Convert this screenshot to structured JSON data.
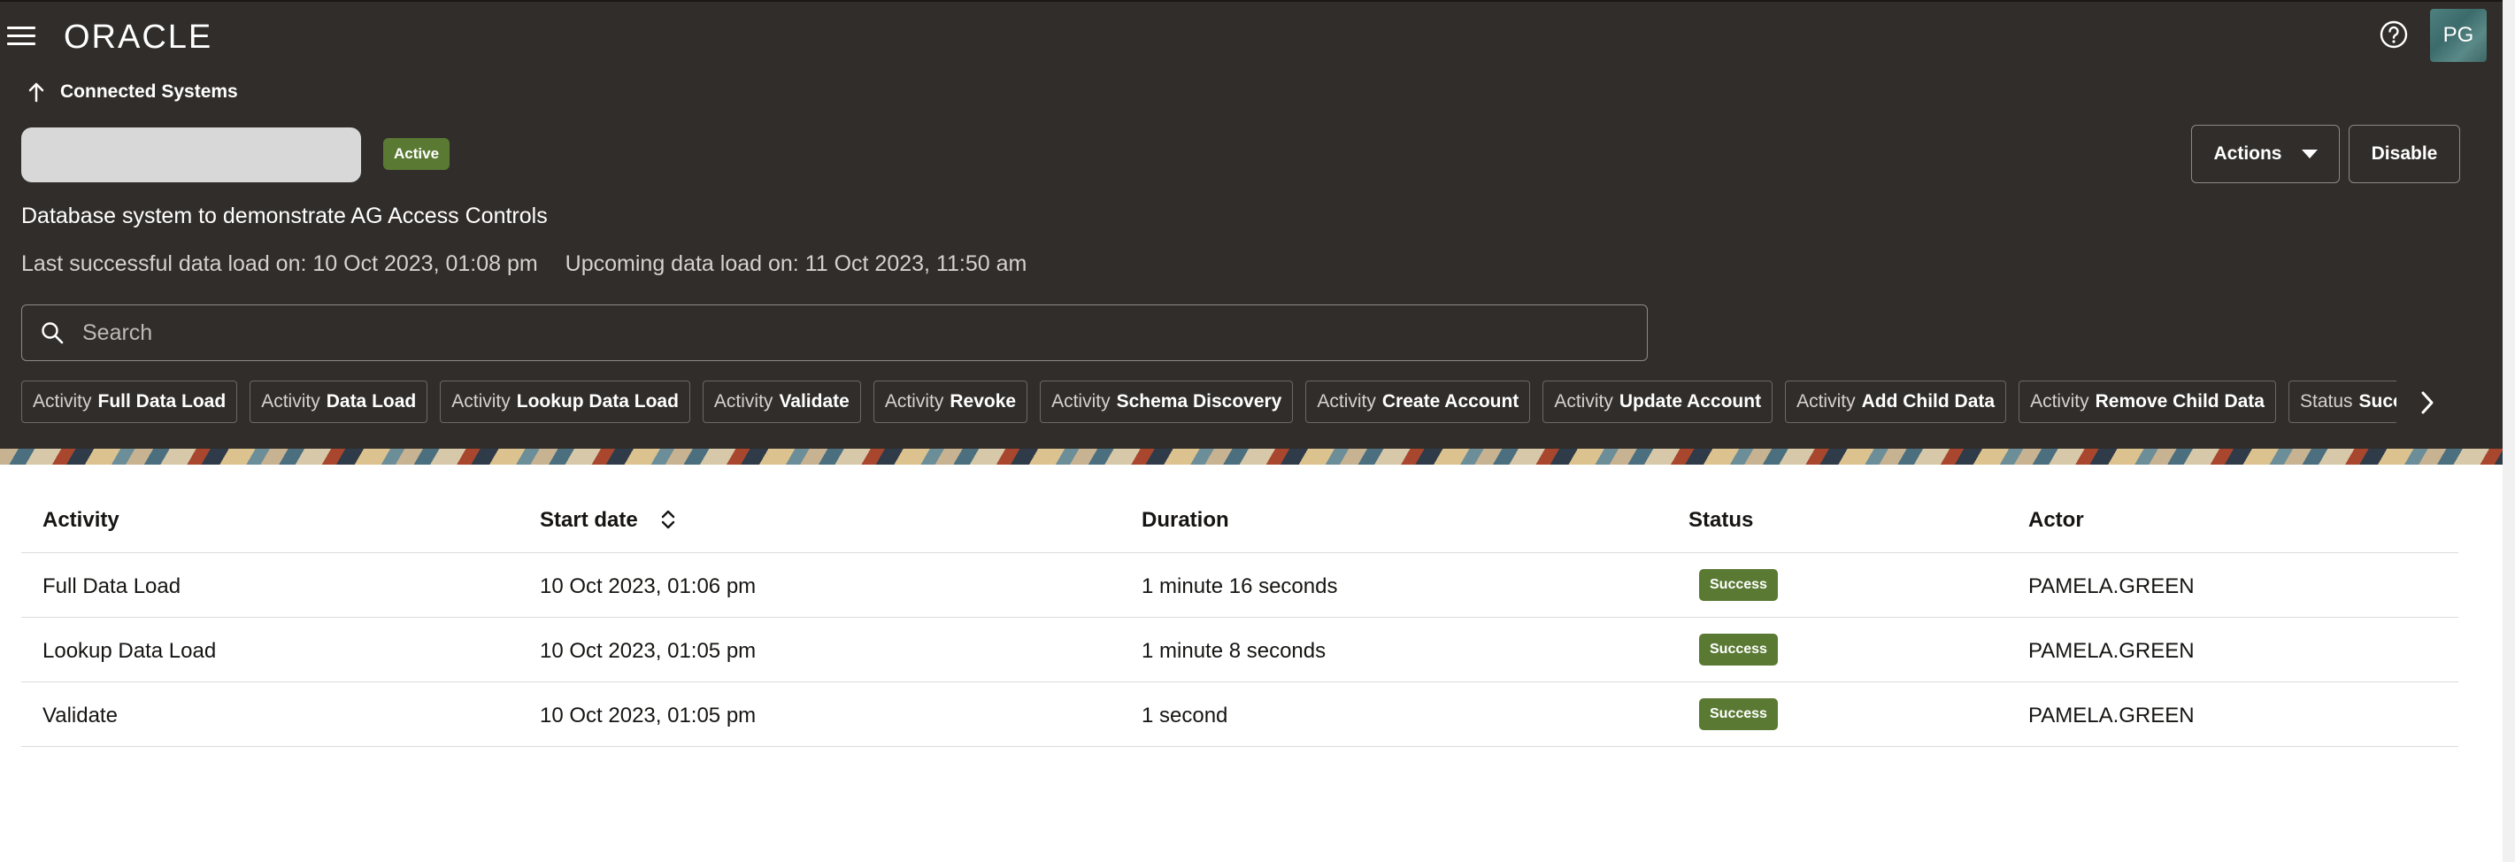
{
  "header": {
    "logo_text": "ORACLE",
    "avatar_initials": "PG",
    "breadcrumb": "Connected Systems",
    "status": "Active",
    "actions_label": "Actions",
    "disable_label": "Disable",
    "description": "Database system to demonstrate AG Access Controls",
    "last_load": "Last successful data load on: 10 Oct 2023, 01:08 pm",
    "upcoming_load": "Upcoming data load on: 11 Oct 2023, 11:50 am",
    "search_placeholder": "Search"
  },
  "filters": [
    {
      "prefix": "Activity",
      "value": "Full Data Load"
    },
    {
      "prefix": "Activity",
      "value": "Data Load"
    },
    {
      "prefix": "Activity",
      "value": "Lookup Data Load"
    },
    {
      "prefix": "Activity",
      "value": "Validate"
    },
    {
      "prefix": "Activity",
      "value": "Revoke"
    },
    {
      "prefix": "Activity",
      "value": "Schema Discovery"
    },
    {
      "prefix": "Activity",
      "value": "Create Account"
    },
    {
      "prefix": "Activity",
      "value": "Update Account"
    },
    {
      "prefix": "Activity",
      "value": "Add Child Data"
    },
    {
      "prefix": "Activity",
      "value": "Remove Child Data"
    },
    {
      "prefix": "Status",
      "value": "Succ"
    }
  ],
  "table": {
    "columns": [
      "Activity",
      "Start date",
      "Duration",
      "Status",
      "Actor"
    ],
    "rows": [
      {
        "activity": "Full Data Load",
        "start": "10 Oct 2023, 01:06 pm",
        "duration": "1 minute 16 seconds",
        "status": "Success",
        "actor": "PAMELA.GREEN"
      },
      {
        "activity": "Lookup Data Load",
        "start": "10 Oct 2023, 01:05 pm",
        "duration": "1 minute 8 seconds",
        "status": "Success",
        "actor": "PAMELA.GREEN"
      },
      {
        "activity": "Validate",
        "start": "10 Oct 2023, 01:05 pm",
        "duration": "1 second",
        "status": "Success",
        "actor": "PAMELA.GREEN"
      }
    ]
  },
  "colors": {
    "header_bg": "#312d2a",
    "success": "#5a7a34"
  }
}
